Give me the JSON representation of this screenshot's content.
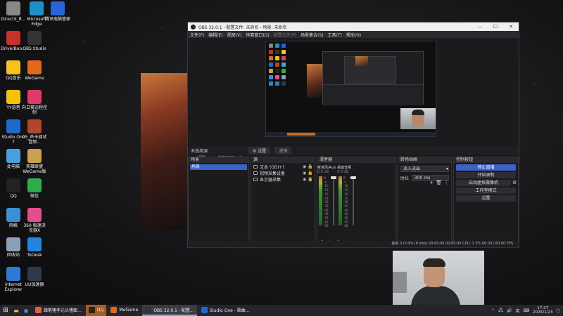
{
  "desktop": {
    "icons": [
      {
        "label": "DirectX_R...",
        "color": "#888"
      },
      {
        "label": "Microsoft Edge",
        "color": "#1e90c8"
      },
      {
        "label": "腾讯电脑管家",
        "color": "#2466d9"
      },
      {
        "label": "DriverBoo...",
        "color": "#c9302c"
      },
      {
        "label": "OBS Studio",
        "color": "#333"
      },
      {
        "label": "QQ音乐",
        "color": "#f7c21d"
      },
      {
        "label": "WeGame",
        "color": "#e06b1e"
      },
      {
        "label": "YY语音",
        "color": "#f2c400"
      },
      {
        "label": "向日葵远程控制",
        "color": "#e03a6b"
      },
      {
        "label": "Studio One 7",
        "color": "#1c6bd1"
      },
      {
        "label": "05_声卡调试音频...",
        "color": "#b1462d"
      },
      {
        "label": "此电脑",
        "color": "#4a9fe0"
      },
      {
        "label": "英雄联盟WeGame版",
        "color": "#c9a24a"
      },
      {
        "label": "QQ",
        "color": "#222"
      },
      {
        "label": "微信",
        "color": "#2aae45"
      },
      {
        "label": "网络",
        "color": "#3a8fd6"
      },
      {
        "label": "360 极速浏览器X",
        "color": "#e74c8c"
      },
      {
        "label": "回收站",
        "color": "#8aa0b8"
      },
      {
        "label": "ToDesk",
        "color": "#1f86e0"
      },
      {
        "label": "Internet Explorer",
        "color": "#2a7ad6"
      },
      {
        "label": "UU加速器",
        "color": "#2f3a48"
      }
    ]
  },
  "obs": {
    "title": "OBS 32.0.1 - 配置文件: 未命名 - 场景: 未命名",
    "window_buttons": [
      "—",
      "☐",
      "✕"
    ],
    "menu": [
      "文件(F)",
      "编辑(E)",
      "视图(V)",
      "停靠窗口(D)",
      "配置文件(P)",
      "场景集合(S)",
      "工具(T)",
      "帮助(H)"
    ],
    "zoom_label": "30%",
    "zoom_mode": "缩放到窗口",
    "source_bar": {
      "selected": "未选择源",
      "properties": "⚙ 设置",
      "filters": "滤镜"
    },
    "scenes": {
      "title": "场景",
      "items": [
        "场景"
      ]
    },
    "sources": {
      "title": "源",
      "items": [
        {
          "name": "文本 (GDI+)"
        },
        {
          "name": "视频采集设备"
        },
        {
          "name": "显示器采集"
        }
      ]
    },
    "mixer": {
      "title": "混音器",
      "channels": [
        {
          "name": "麦克风/Aux",
          "db": "0.0 dB",
          "fader": 0.0
        },
        {
          "name": "桌面音频",
          "db": "0.0 dB",
          "fader": 0.0
        }
      ],
      "scale": [
        "0",
        "-5",
        "-10",
        "-15",
        "-20",
        "-25",
        "-30",
        "-35",
        "-40",
        "-45",
        "-50",
        "-55",
        "-60"
      ]
    },
    "transitions": {
      "title": "转场动画",
      "type": "淡入淡出",
      "duration_label": "时长",
      "duration": "300 ms"
    },
    "controls": {
      "title": "控制按钮",
      "buttons": [
        "停止直播",
        "开始录制",
        "启动虚拟摄像机",
        "工作室模式",
        "设置"
      ]
    },
    "status": "丢帧 0 (0.0%)    0 kbps    00:00:00    00:00:00    CPU: 1.3%  60.00 / 60.00 FPS"
  },
  "taskbar": {
    "apps": [
      {
        "label": "蜡笔猪手元头猪面...",
        "color": "#e0623a",
        "active": false,
        "orange": false
      },
      {
        "label": "QQ",
        "color": "#222",
        "active": false,
        "orange": true
      },
      {
        "label": "WeGame",
        "color": "#e06b1e",
        "active": false,
        "orange": false
      },
      {
        "label": "OBS 32.0.1 - 配置...",
        "color": "#333",
        "active": true,
        "orange": false
      },
      {
        "label": "Studio One - 歌曲...",
        "color": "#1c6bd1",
        "active": false,
        "orange": false
      }
    ],
    "ime": "英",
    "time": "17:27",
    "date": "2026/1/23"
  }
}
